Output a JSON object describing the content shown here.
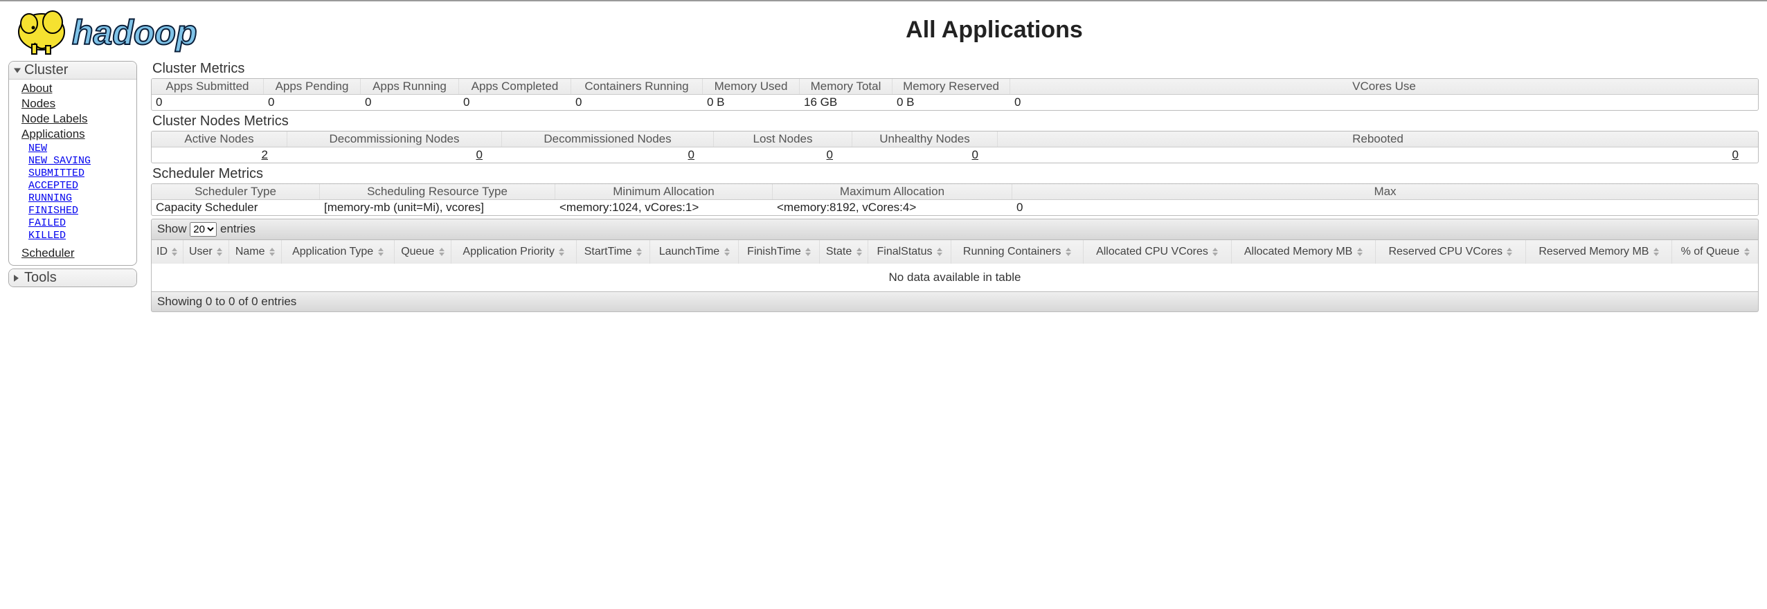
{
  "page_title": "All Applications",
  "logo_text": "hadoop",
  "sidebar": {
    "cluster_header": "Cluster",
    "tools_header": "Tools",
    "links": {
      "about": "About",
      "nodes": "Nodes",
      "node_labels": "Node Labels",
      "applications": "Applications",
      "scheduler": "Scheduler"
    },
    "app_states": [
      "NEW",
      "NEW_SAVING",
      "SUBMITTED",
      "ACCEPTED",
      "RUNNING",
      "FINISHED",
      "FAILED",
      "KILLED"
    ]
  },
  "cluster_metrics": {
    "title": "Cluster Metrics",
    "headers": [
      "Apps Submitted",
      "Apps Pending",
      "Apps Running",
      "Apps Completed",
      "Containers Running",
      "Memory Used",
      "Memory Total",
      "Memory Reserved",
      "VCores Use"
    ],
    "values": [
      "0",
      "0",
      "0",
      "0",
      "0",
      "0 B",
      "16 GB",
      "0 B",
      "0"
    ]
  },
  "nodes_metrics": {
    "title": "Cluster Nodes Metrics",
    "headers": [
      "Active Nodes",
      "Decommissioning Nodes",
      "Decommissioned Nodes",
      "Lost Nodes",
      "Unhealthy Nodes",
      "Rebooted "
    ],
    "values": [
      "2",
      "0",
      "0",
      "0",
      "0",
      "0"
    ]
  },
  "scheduler_metrics": {
    "title": "Scheduler Metrics",
    "headers": [
      "Scheduler Type",
      "Scheduling Resource Type",
      "Minimum Allocation",
      "Maximum Allocation",
      "Max"
    ],
    "values": [
      "Capacity Scheduler",
      "[memory-mb (unit=Mi), vcores]",
      "<memory:1024, vCores:1>",
      "<memory:8192, vCores:4>",
      "0"
    ]
  },
  "datatable": {
    "show_label_prefix": "Show",
    "show_label_suffix": "entries",
    "page_size": "20",
    "columns": [
      "ID",
      "User",
      "Name",
      "Application Type",
      "Queue",
      "Application Priority",
      "StartTime",
      "LaunchTime",
      "FinishTime",
      "State",
      "FinalStatus",
      "Running Containers",
      "Allocated CPU VCores",
      "Allocated Memory MB",
      "Reserved CPU VCores",
      "Reserved Memory MB",
      "% of Queue"
    ],
    "empty_msg": "No data available in table",
    "status": "Showing 0 to 0 of 0 entries"
  }
}
